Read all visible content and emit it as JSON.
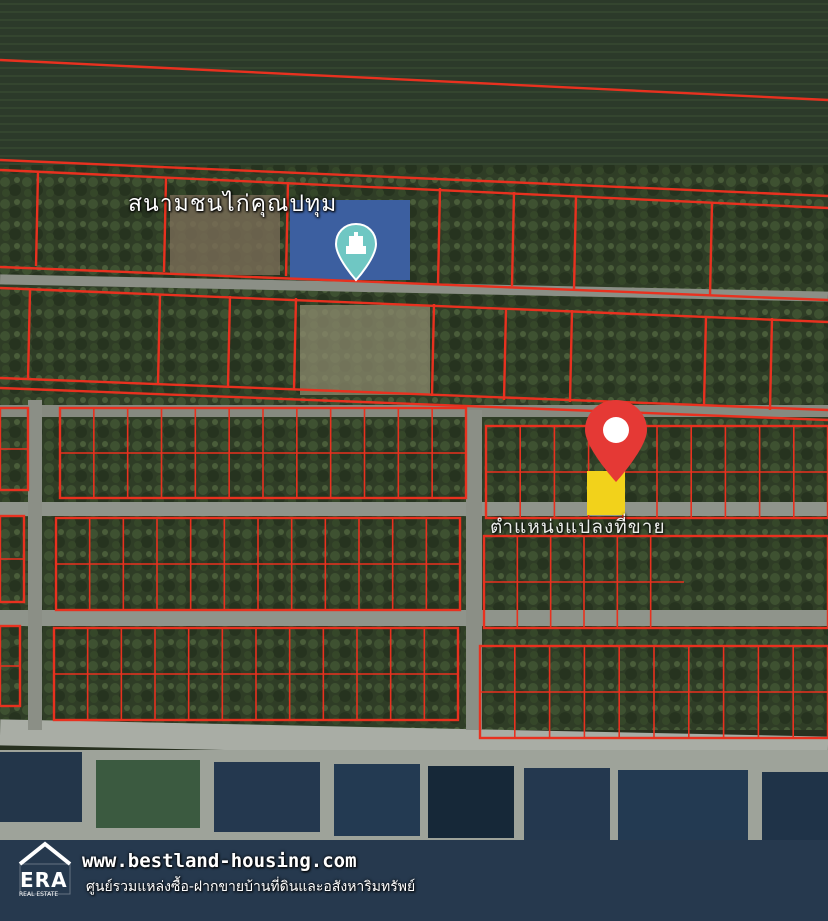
{
  "map": {
    "poi": {
      "name": "สนามชนไก่คุณปทุม",
      "icon": "monument-pin-icon",
      "pin_color": "#6fc7c3"
    },
    "target": {
      "label": "ตำแหน่งแปลงที่ขาย",
      "pin_icon": "red-location-pin-icon",
      "pin_color": "#e53935",
      "marker_color": "#f2d21b"
    },
    "parcel_line_color": "#e8311f"
  },
  "branding": {
    "logo_icon": "era-house-logo-icon",
    "logo_text": "ERA",
    "logo_sub": "REAL ESTATE",
    "url": "www.bestland-housing.com",
    "tagline": "ศูนย์รวมแหล่งซื้อ-ฝากขายบ้านที่ดินและอสังหาริมทรัพย์"
  }
}
